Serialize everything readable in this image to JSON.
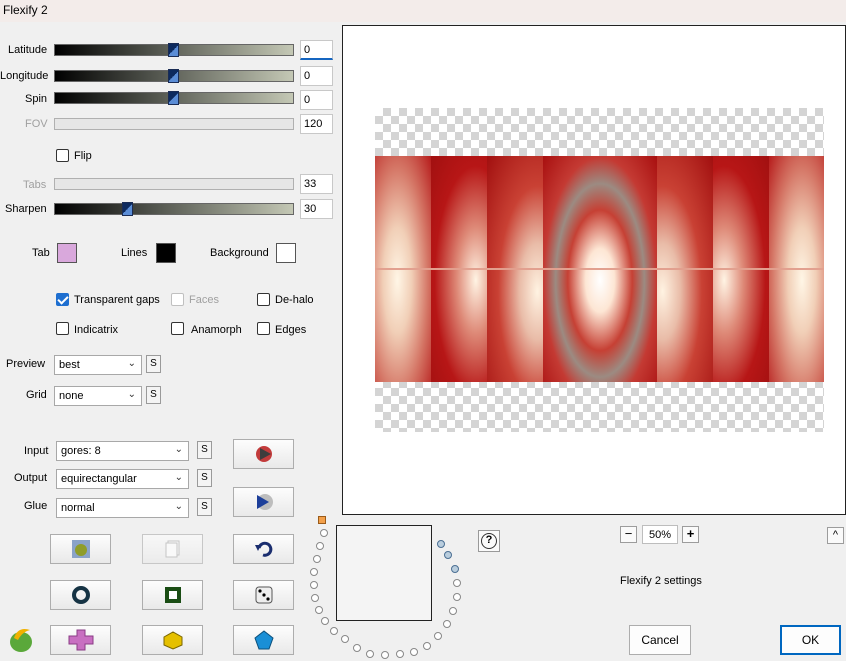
{
  "window": {
    "title": "Flexify 2"
  },
  "params": {
    "latitude": {
      "label": "Latitude",
      "value": "0",
      "level": 0.5
    },
    "longitude": {
      "label": "Longitude",
      "value": "0",
      "level": 0.5
    },
    "spin": {
      "label": "Spin",
      "value": "0",
      "level": 0.5
    },
    "fov": {
      "label": "FOV",
      "value": "120"
    },
    "flip": {
      "label": "Flip",
      "checked": false
    },
    "tabs": {
      "label": "Tabs",
      "value": "33"
    },
    "sharpen": {
      "label": "Sharpen",
      "value": "30",
      "level": 0.3
    }
  },
  "colors": {
    "tab": {
      "label": "Tab",
      "color": "#d9a8dc"
    },
    "lines": {
      "label": "Lines",
      "color": "#000000"
    },
    "background": {
      "label": "Background",
      "color": "#ffffff"
    }
  },
  "options": {
    "transparent_gaps": {
      "label": "Transparent gaps",
      "checked": true
    },
    "faces": {
      "label": "Faces",
      "checked": false,
      "disabled": true
    },
    "de_halo": {
      "label": "De-halo",
      "checked": false
    },
    "indicatrix": {
      "label": "Indicatrix",
      "checked": false
    },
    "anamorph": {
      "label": "Anamorph",
      "checked": false
    },
    "edges": {
      "label": "Edges",
      "checked": false
    }
  },
  "selects": {
    "preview": {
      "label": "Preview",
      "value": "best"
    },
    "grid": {
      "label": "Grid",
      "value": "none"
    },
    "input": {
      "label": "Input",
      "value": "gores: 8"
    },
    "output": {
      "label": "Output",
      "value": "equirectangular"
    },
    "glue": {
      "label": "Glue",
      "value": "normal"
    }
  },
  "sbutton_label": "S",
  "zoom": {
    "value": "50%",
    "minus": "−",
    "plus": "+"
  },
  "help_label": "?",
  "collapse_label": "^",
  "settings_label": "Flexify 2 settings",
  "buttons": {
    "cancel": "Cancel",
    "ok": "OK"
  },
  "accent": "#0067c0"
}
